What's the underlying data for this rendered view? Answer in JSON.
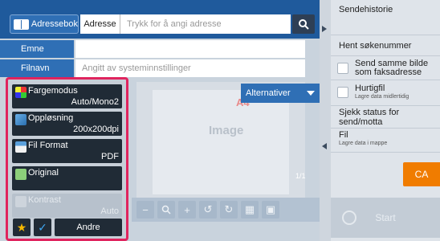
{
  "header": {
    "address_book_button": "Adressebok",
    "address_label": "Adresse",
    "address_placeholder": "Trykk for å angi adresse",
    "search_icon": "search-icon"
  },
  "fields": {
    "subject_label": "Emne",
    "subject_value": "",
    "filename_label": "Filnavn",
    "filename_placeholder": "Angitt av systeminnstillinger"
  },
  "preview": {
    "paper_size": "A4",
    "image_label": "Image",
    "page_count": "1/1",
    "alternatives_button": "Alternativer"
  },
  "settings": [
    {
      "name": "Fargemodus",
      "value": "Auto/Mono2",
      "icon": "color-mode-icon",
      "enabled": true
    },
    {
      "name": "Oppløsning",
      "value": "200x200dpi",
      "icon": "resolution-icon",
      "enabled": true
    },
    {
      "name": "Fil Format",
      "value": "PDF",
      "icon": "file-format-icon",
      "enabled": true
    },
    {
      "name": "Original",
      "value": "",
      "icon": "original-icon",
      "enabled": true
    },
    {
      "name": "Kontrast",
      "value": "Auto",
      "icon": "contrast-icon",
      "enabled": false
    }
  ],
  "settings_footer": {
    "others_button": "Andre"
  },
  "right_panel": {
    "send_history": "Sendehistorie",
    "fetch_search_number": "Hent søkenummer",
    "send_same_image": "Send samme bilde som faksadresse",
    "quick_file": "Hurtigfil",
    "quick_file_sub": "Lagre data midlertidig",
    "check_status": "Sjekk status for send/motta",
    "file": "Fil",
    "file_sub": "Lagre data i mappe",
    "ca_button": "CA",
    "start_button": "Start"
  },
  "colors": {
    "accent_blue": "#2f6fb5",
    "highlight_red": "#e0245e",
    "ca_orange": "#f07c00"
  }
}
